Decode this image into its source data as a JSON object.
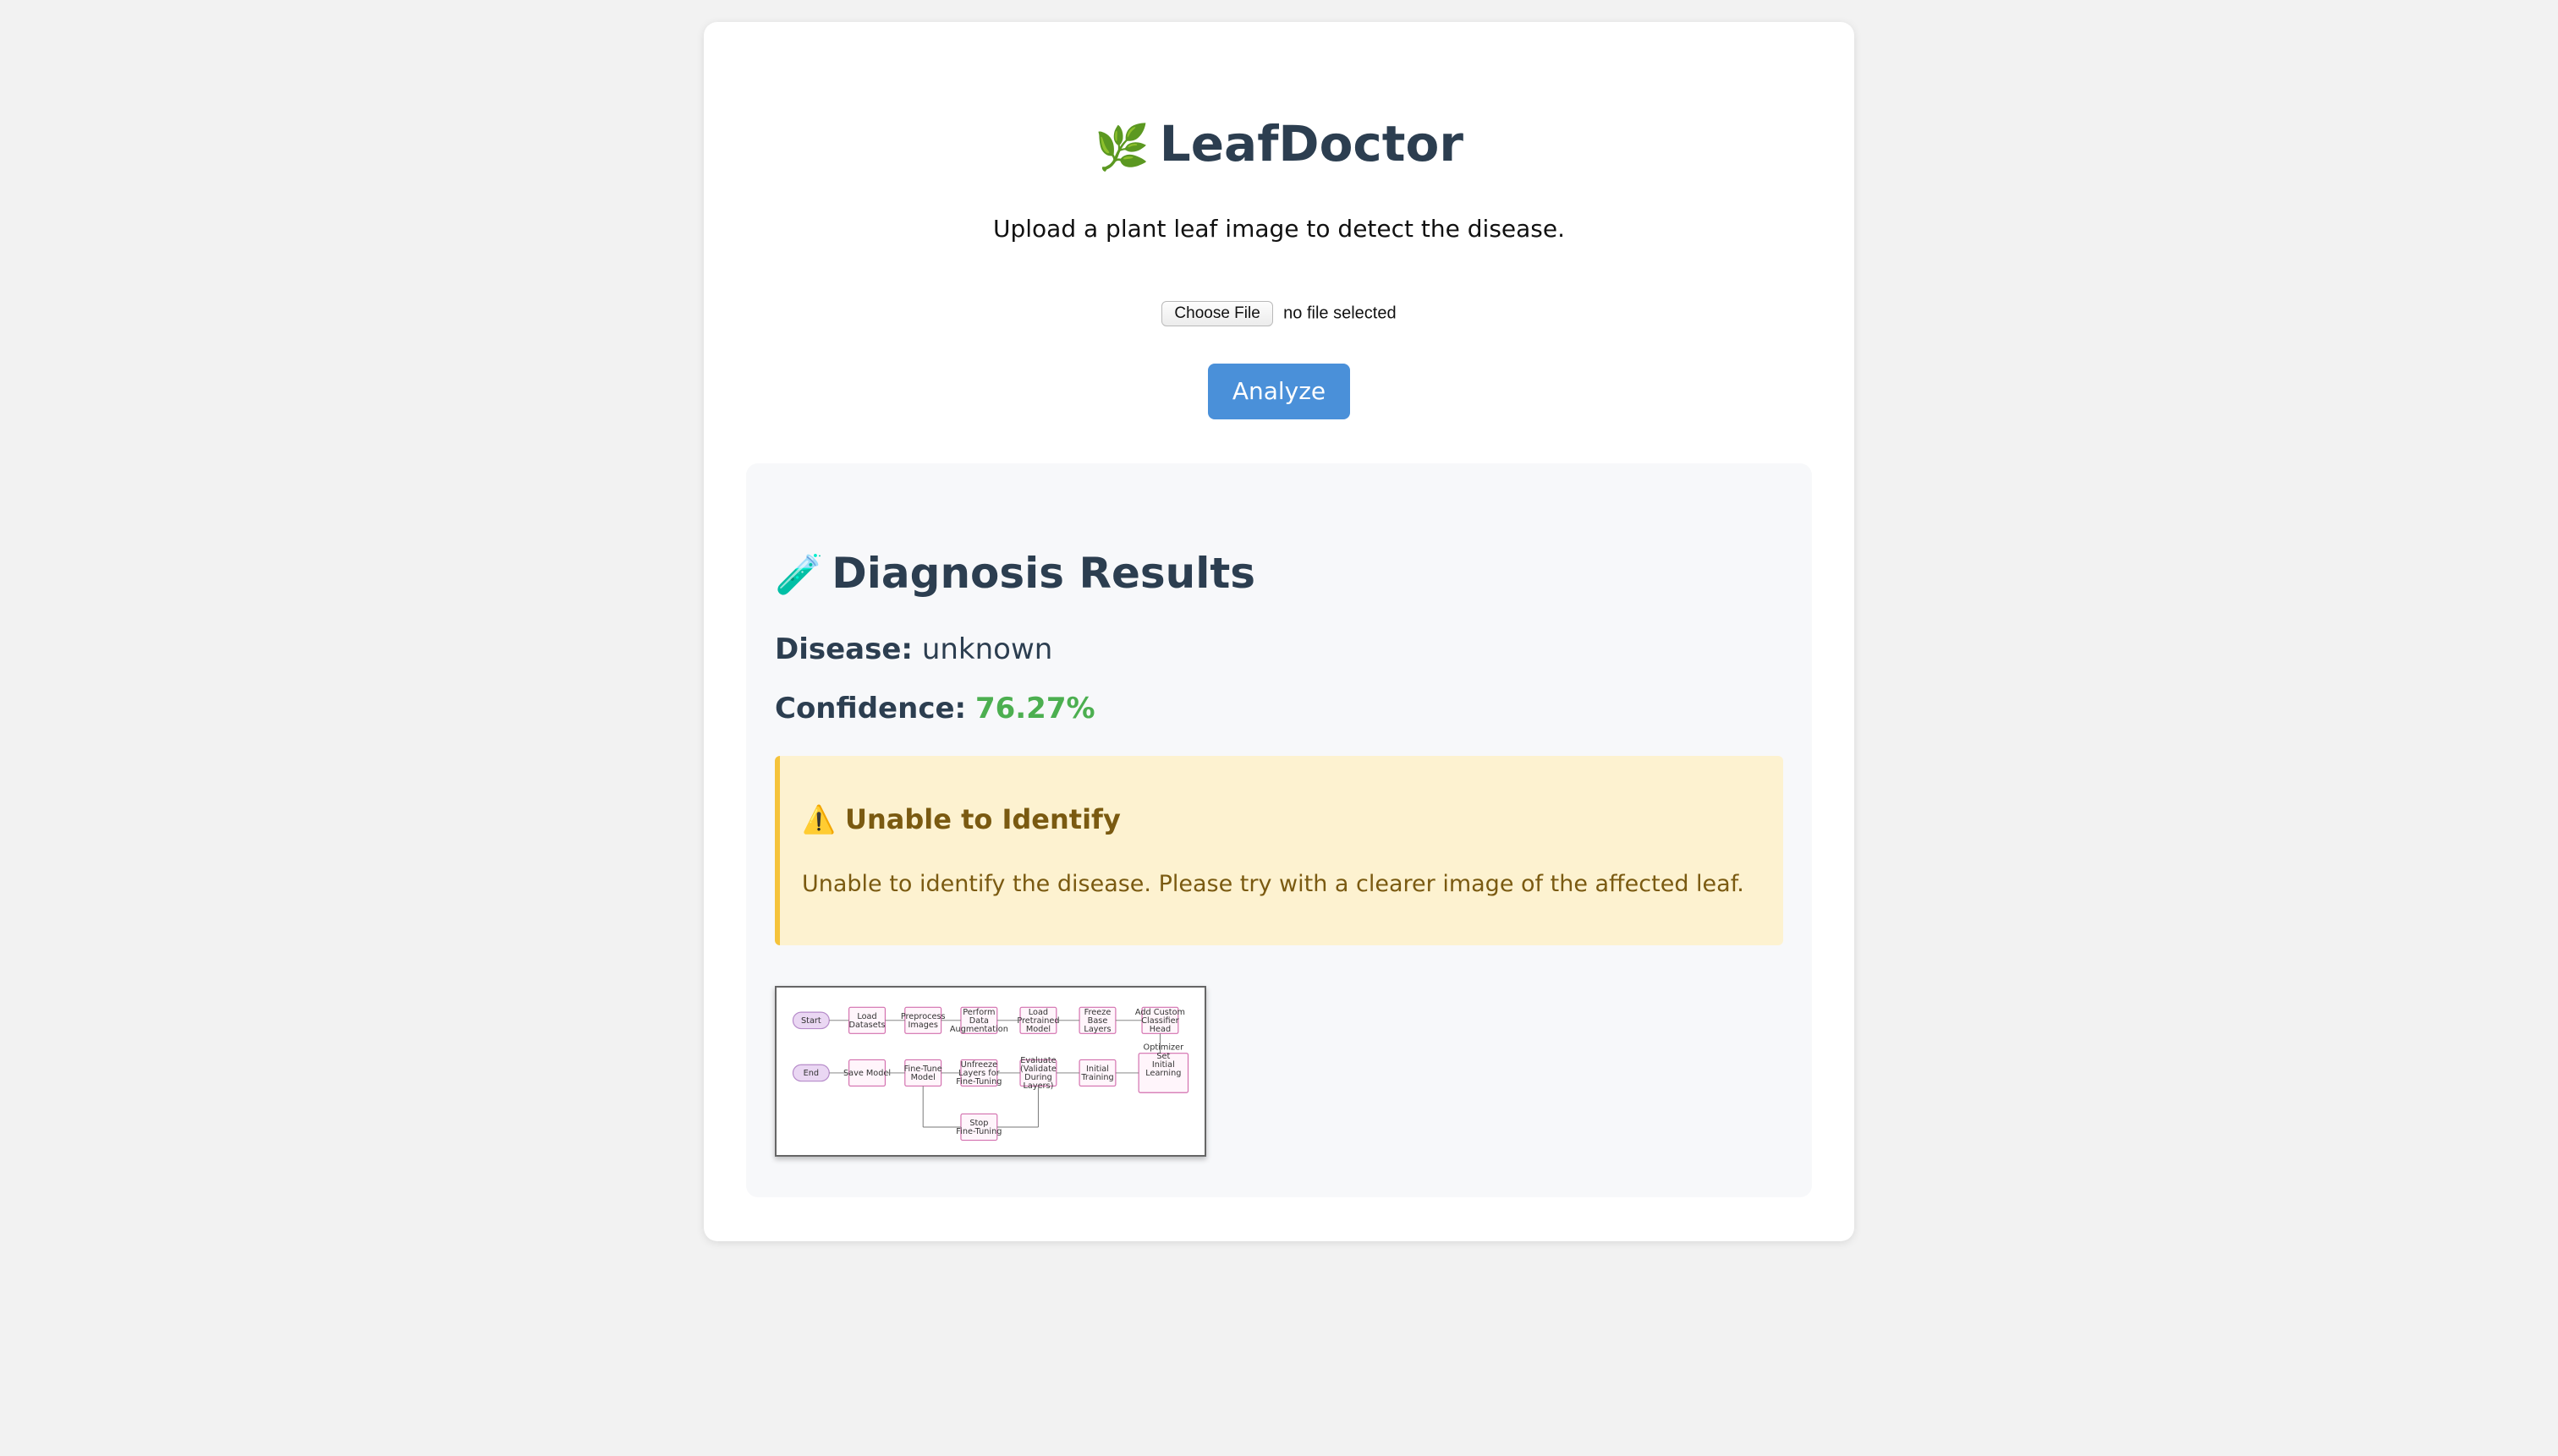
{
  "app": {
    "title": "LeafDoctor",
    "logo_icon": "🌿",
    "subtitle": "Upload a plant leaf image to detect the disease."
  },
  "upload": {
    "choose_label": "Choose File",
    "file_status": "no file selected",
    "analyze_label": "Analyze"
  },
  "results": {
    "icon": "🧪",
    "title": "Diagnosis Results",
    "disease_label": "Disease:",
    "disease_value": "unknown",
    "confidence_label": "Confidence:",
    "confidence_value": "76.27%",
    "alert": {
      "icon": "⚠️",
      "title": "Unable to Identify",
      "message": "Unable to identify the disease. Please try with a clearer image of the affected leaf."
    }
  },
  "flowchart": {
    "top_row": [
      "Start",
      "Load Datasets",
      "Preprocess Images",
      "Perform Data Augmentation",
      "Load Pretrained Model",
      "Freeze Base Layers",
      "Add Custom Classifier Head"
    ],
    "bottom_row": [
      "End",
      "Save Model",
      "Fine-Tune Model",
      "Unfreeze Layers for Fine-Tuning",
      "Evaluate (Validate During Layers)",
      "Initial Training",
      "Optimizer Set Initial Learning Rate and Epoch Numbers"
    ],
    "extra": "Stop Fine-Tuning"
  },
  "colors": {
    "background": "#f2f2f2",
    "accent_button": "#4a90d9",
    "confidence": "#4caf50",
    "alert_bg": "#fdf2d0",
    "alert_border": "#f5c33b",
    "heading": "#2c3e50"
  }
}
